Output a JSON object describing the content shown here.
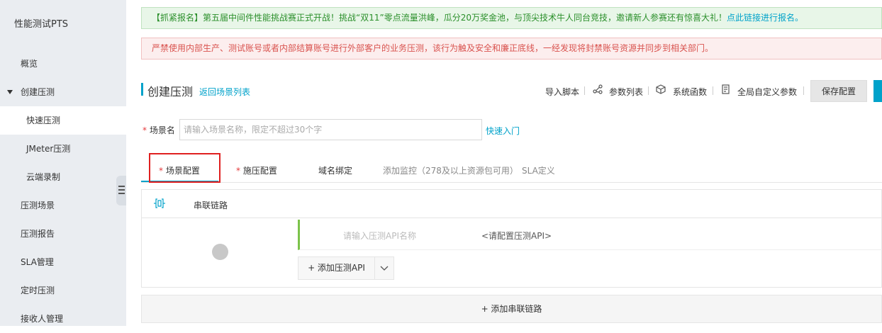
{
  "sidebar": {
    "title": "性能测试PTS",
    "items": [
      {
        "label": "概览"
      },
      {
        "label": "创建压测"
      },
      {
        "label": "快速压测"
      },
      {
        "label": "JMeter压测"
      },
      {
        "label": "云端录制"
      },
      {
        "label": "压测场景"
      },
      {
        "label": "压测报告"
      },
      {
        "label": "SLA管理"
      },
      {
        "label": "定时压测"
      },
      {
        "label": "接收人管理"
      }
    ]
  },
  "notices": {
    "promo_text": "【抓紧报名】第五届中间件性能挑战赛正式开战！挑战“双11”零点流量洪峰，瓜分20万奖金池，与顶尖技术牛人同台竞技，邀请新人参赛还有惊喜大礼！",
    "promo_link": "点此链接进行报名。",
    "warning": "严禁使用内部生产、测试账号或者内部结算账号进行外部客户的业务压测，该行为触及安全和廉正底线，一经发现将封禁账号资源并同步到相关部门。"
  },
  "header": {
    "title": "创建压测",
    "back_link": "返回场景列表",
    "toolbar": {
      "import_script": "导入脚本",
      "param_list": "参数列表",
      "system_functions": "系统函数",
      "global_params": "全局自定义参数",
      "save": "保存配置"
    }
  },
  "scene_name": {
    "required_mark": "*",
    "label": "场景名",
    "placeholder": "请输入场景名称，限定不超过30个字",
    "value": "",
    "quick_start": "快速入门"
  },
  "tabs": {
    "required_mark": "*",
    "items": [
      {
        "label": "场景配置",
        "required": true,
        "active": true
      },
      {
        "label": "施压配置",
        "required": true
      },
      {
        "label": "域名绑定"
      },
      {
        "label": "添加监控（278及以上资源包可用）"
      },
      {
        "label": "SLA定义"
      }
    ]
  },
  "chain": {
    "label": "串联链路",
    "api_name_placeholder": "请输入压测API名称",
    "api_config_text": "<请配置压测API>",
    "add_api_label": "+ 添加压测API",
    "add_chain_label": "+ 添加串联链路"
  },
  "colors": {
    "accent": "#00a2ca",
    "required": "#e4393c",
    "highlight_box": "#e02020",
    "api_bar": "#7cc34a"
  }
}
